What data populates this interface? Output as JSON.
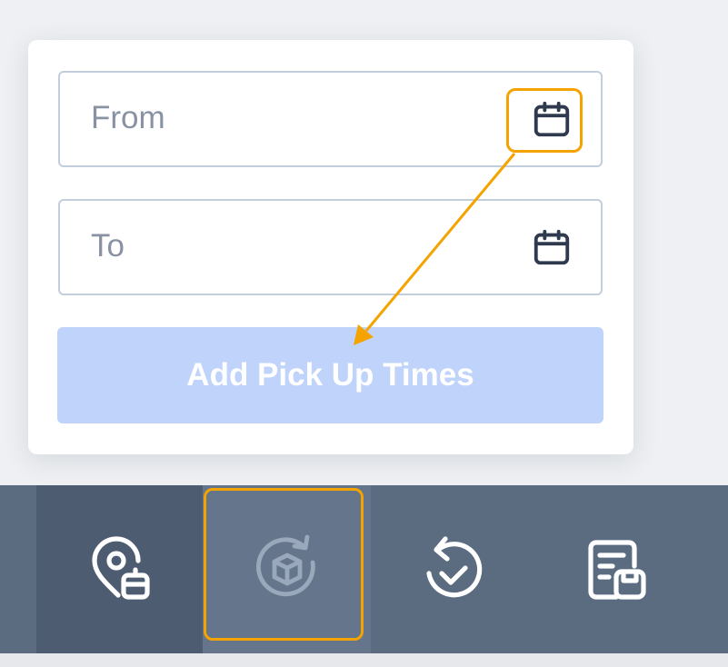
{
  "filter_popup": {
    "from_placeholder": "From",
    "to_placeholder": "To",
    "add_button_label": "Add Pick Up Times",
    "button_state": "disabled"
  },
  "icons": {
    "from_calendar": "calendar-icon",
    "to_calendar": "calendar-icon"
  },
  "bottom_nav": {
    "items": [
      {
        "icon": "location-pin-box-icon"
      },
      {
        "icon": "box-cycle-icon",
        "state": "disabled"
      },
      {
        "icon": "return-check-icon"
      },
      {
        "icon": "order-package-icon"
      }
    ]
  },
  "colors": {
    "highlight": "#f5a300",
    "button_disabled": "#bfd3fb",
    "nav_background": "#5b6b80",
    "nav_active": "#4d5c71"
  }
}
